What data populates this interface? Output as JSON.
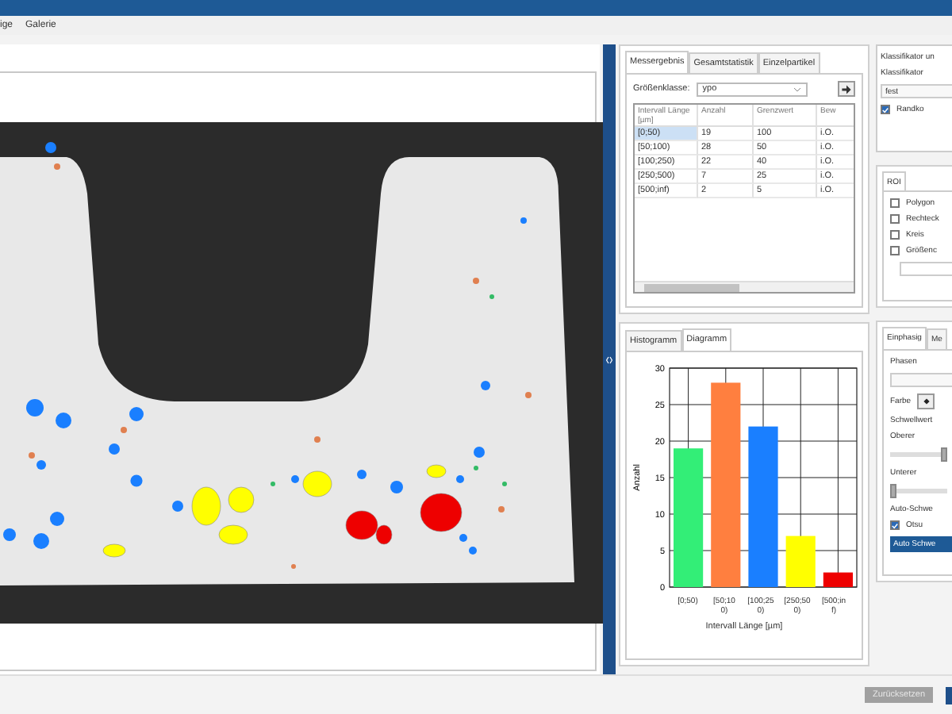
{
  "menu": [
    "ige",
    "Galerie"
  ],
  "results_panel": {
    "tabs": [
      {
        "label": "Messergebnis",
        "selected": true
      },
      {
        "label": "Gesamtstatistik",
        "selected": false
      },
      {
        "label": "Einzelpartikel",
        "selected": false
      }
    ],
    "size_class": {
      "label": "Größenklasse:",
      "value": "ypo"
    },
    "table": {
      "columns": [
        "Intervall Länge [µm]",
        "Anzahl",
        "Grenzwert",
        "Bew"
      ],
      "rows": [
        {
          "cells": [
            "[0;50)",
            "19",
            "100",
            "i.O."
          ],
          "selected": true
        },
        {
          "cells": [
            "[50;100)",
            "28",
            "50",
            "i.O."
          ],
          "selected": false
        },
        {
          "cells": [
            "[100;250)",
            "22",
            "40",
            "i.O."
          ],
          "selected": false
        },
        {
          "cells": [
            "[250;500)",
            "7",
            "25",
            "i.O."
          ],
          "selected": false
        },
        {
          "cells": [
            "[500;inf)",
            "2",
            "5",
            "i.O."
          ],
          "selected": false
        }
      ]
    }
  },
  "chart_panel": {
    "tabs": [
      {
        "label": "Histogramm",
        "selected": false
      },
      {
        "label": "Diagramm",
        "selected": true
      }
    ],
    "chart_data": {
      "type": "bar",
      "xlabel": "Intervall Länge [µm]",
      "ylabel": "Anzahl",
      "categories": [
        "[0;50)",
        "[50;100)",
        "[100;250)",
        "[250;500)",
        "[500;inf)"
      ],
      "values": [
        19,
        28,
        22,
        7,
        2
      ],
      "colors": [
        "#33ee77",
        "#ff7f3f",
        "#1a7fff",
        "#ffff00",
        "#ee0000"
      ],
      "grid": true,
      "ylim": [
        0,
        30
      ],
      "yticks": [
        0,
        5,
        10,
        15,
        20,
        25,
        30
      ]
    }
  },
  "classifier": {
    "title": "Klassifikator un",
    "label": "Klassifikator",
    "value": "fest",
    "checkbox": {
      "label": "Randko",
      "checked": true
    }
  },
  "roi": {
    "tabs": [
      {
        "label": "ROI",
        "selected": true
      }
    ],
    "options": [
      {
        "label": "Polygon",
        "checked": false
      },
      {
        "label": "Rechteck",
        "checked": false
      },
      {
        "label": "Kreis",
        "checked": false
      },
      {
        "label": "Größenc",
        "checked": false
      }
    ]
  },
  "threshold": {
    "tabs": [
      {
        "label": "Einphasig",
        "selected": true
      },
      {
        "label": "Me",
        "selected": false
      }
    ],
    "phases_label": "Phasen",
    "color_label": "Farbe",
    "threshold_label": "Schwellwert",
    "upper": {
      "label": "Oberer",
      "level": 1
    },
    "lower": {
      "label": "Unterer",
      "level": 0
    },
    "auto_label": "Auto-Schwe",
    "otsu": {
      "label": "Otsu",
      "checked": true
    },
    "auto_button": "Auto Schwe"
  },
  "footer": {
    "reset_button": {
      "label": "Zurücksetzen",
      "disabled": true
    }
  }
}
